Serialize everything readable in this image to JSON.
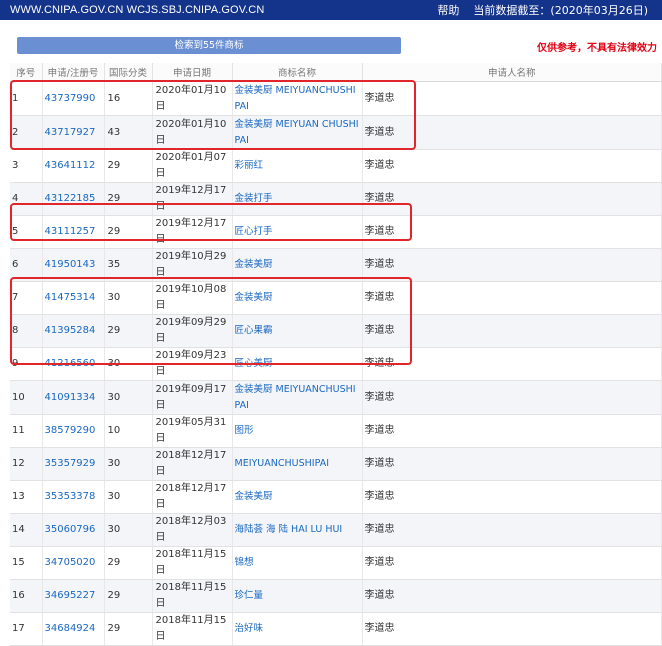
{
  "topbar": {
    "site": "WWW.CNIPA.GOV.CN WCJS.SBJ.CNIPA.GOV.CN",
    "help": "帮助",
    "date_notice": "当前数据截至：(2020年03月26日)"
  },
  "result_bar": "检索到55件商标",
  "disclaimer": "仅供参考，不具有法律效力",
  "headers": [
    "序号",
    "申请/注册号",
    "国际分类",
    "申请日期",
    "商标名称",
    "申请人名称"
  ],
  "rows": [
    {
      "no": "1",
      "reg": "43737990",
      "cls": "16",
      "date": "2020年01月10日",
      "name": "金装美厨 MEIYUANCHUSHIPAI",
      "applicant": "李道忠"
    },
    {
      "no": "2",
      "reg": "43717927",
      "cls": "43",
      "date": "2020年01月10日",
      "name": "金装美厨 MEIYUAN CHUSHIPAI",
      "applicant": "李道忠"
    },
    {
      "no": "3",
      "reg": "43641112",
      "cls": "29",
      "date": "2020年01月07日",
      "name": "彩丽红",
      "applicant": "李道忠"
    },
    {
      "no": "4",
      "reg": "43122185",
      "cls": "29",
      "date": "2019年12月17日",
      "name": "金装打手",
      "applicant": "李道忠"
    },
    {
      "no": "5",
      "reg": "43111257",
      "cls": "29",
      "date": "2019年12月17日",
      "name": "匠心打手",
      "applicant": "李道忠"
    },
    {
      "no": "6",
      "reg": "41950143",
      "cls": "35",
      "date": "2019年10月29日",
      "name": "金装美厨",
      "applicant": "李道忠"
    },
    {
      "no": "7",
      "reg": "41475314",
      "cls": "30",
      "date": "2019年10月08日",
      "name": "金装美厨",
      "applicant": "李道忠"
    },
    {
      "no": "8",
      "reg": "41395284",
      "cls": "29",
      "date": "2019年09月29日",
      "name": "匠心果霸",
      "applicant": "李道忠"
    },
    {
      "no": "9",
      "reg": "41216560",
      "cls": "30",
      "date": "2019年09月23日",
      "name": "匠心美厨",
      "applicant": "李道忠"
    },
    {
      "no": "10",
      "reg": "41091334",
      "cls": "30",
      "date": "2019年09月17日",
      "name": "金装美厨 MEIYUANCHUSHIPAI",
      "applicant": "李道忠"
    },
    {
      "no": "11",
      "reg": "38579290",
      "cls": "10",
      "date": "2019年05月31日",
      "name": "图形",
      "applicant": "李道忠"
    },
    {
      "no": "12",
      "reg": "35357929",
      "cls": "30",
      "date": "2018年12月17日",
      "name": "MEIYUANCHUSHIPAI",
      "applicant": "李道忠"
    },
    {
      "no": "13",
      "reg": "35353378",
      "cls": "30",
      "date": "2018年12月17日",
      "name": "金装美厨",
      "applicant": "李道忠"
    },
    {
      "no": "14",
      "reg": "35060796",
      "cls": "30",
      "date": "2018年12月03日",
      "name": "海陆荟 海 陆 HAI LU HUI",
      "applicant": "李道忠"
    },
    {
      "no": "15",
      "reg": "34705020",
      "cls": "29",
      "date": "2018年11月15日",
      "name": "锦想",
      "applicant": "李道忠"
    },
    {
      "no": "16",
      "reg": "34695227",
      "cls": "29",
      "date": "2018年11月15日",
      "name": "珍仁量",
      "applicant": "李道忠"
    },
    {
      "no": "17",
      "reg": "34684924",
      "cls": "29",
      "date": "2018年11月15日",
      "name": "治好味",
      "applicant": "李道忠"
    }
  ],
  "colors": {
    "topbar": "#14338a",
    "result_bar": "#6a8fd2",
    "link": "#1a68c2",
    "disclaimer": "#e60012",
    "highlight": "#e0262b"
  }
}
